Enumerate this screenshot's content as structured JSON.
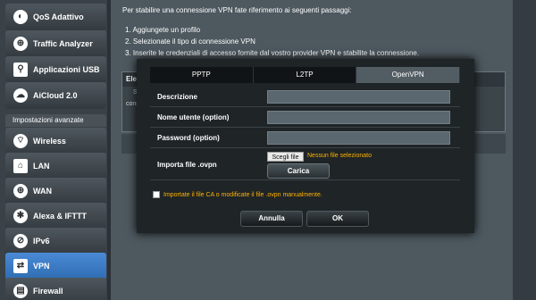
{
  "sidebar": {
    "items": [
      {
        "label": "QoS Adattivo",
        "icon": "qos-icon"
      },
      {
        "label": "Traffic Analyzer",
        "icon": "globe-icon"
      },
      {
        "label": "Applicazioni USB",
        "icon": "usb-icon"
      },
      {
        "label": "AiCloud 2.0",
        "icon": "cloud-icon"
      }
    ],
    "group_label": "Impostazioni avanzate",
    "advanced_items": [
      {
        "label": "Wireless",
        "icon": "wireless-icon"
      },
      {
        "label": "LAN",
        "icon": "lan-icon"
      },
      {
        "label": "WAN",
        "icon": "globe-icon"
      },
      {
        "label": "Alexa & IFTTT",
        "icon": "alexa-icon"
      },
      {
        "label": "IPv6",
        "icon": "ipv6-icon"
      },
      {
        "label": "VPN",
        "icon": "vpn-icon",
        "active": true
      },
      {
        "label": "Firewall",
        "icon": "firewall-icon"
      }
    ]
  },
  "main": {
    "intro": "Per stabilire una connessione VPN fate riferimento ai seguenti passaggi:",
    "steps": [
      "1. Aggiungete un profilo",
      "2. Selezionate il tipo di connessione VPN",
      "3. Inserite le credenziali di accesso fornite dal vostro provider VPN e stabilite la connessione."
    ],
    "table_head": "Ele",
    "table_cells": [
      "S",
      "conn"
    ]
  },
  "modal": {
    "tabs": [
      "PPTP",
      "L2TP",
      "OpenVPN"
    ],
    "active_tab": "OpenVPN",
    "fields": {
      "description_label": "Descrizione",
      "description_value": "",
      "username_label": "Nome utente (option)",
      "username_value": "",
      "password_label": "Password (option)",
      "password_value": ""
    },
    "import": {
      "label": "Importa file .ovpn",
      "choose_label": "Scegli file",
      "no_file_text": "Nessun file selezionato",
      "upload_label": "Carica"
    },
    "ca_text": "Importate il file CA o modificate il file .ovpn manualmente.",
    "cancel_label": "Annulla",
    "ok_label": "OK"
  },
  "colors": {
    "accent": "#2f6db2",
    "warning": "#ffb300"
  }
}
